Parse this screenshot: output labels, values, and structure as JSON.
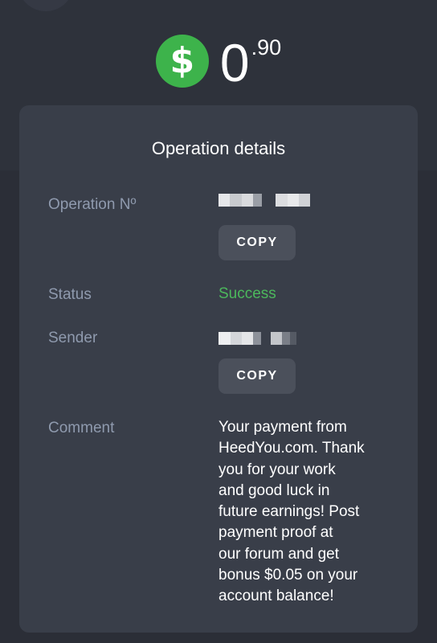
{
  "amount": {
    "currency_symbol": "$",
    "integer": "0",
    "fraction": ".90"
  },
  "details": {
    "title": "Operation details",
    "operation_label": "Operation Nº",
    "status_label": "Status",
    "status_value": "Success",
    "sender_label": "Sender",
    "comment_label": "Comment",
    "copy_label": "COPY",
    "comment_lines": [
      "Your payment from",
      "HeedYou.com. Thank",
      "you for your work",
      "and good luck in",
      "future earnings! Post",
      "payment proof at",
      "our forum and get",
      "bonus $0.05 on your",
      "account balance!"
    ]
  },
  "colors": {
    "accent_green": "#3db34b",
    "success_text": "#4cb85c",
    "card_bg": "#393e49",
    "label_text": "#8f9aae"
  },
  "icons": {
    "amount_icon": "dollar-coin-icon"
  }
}
